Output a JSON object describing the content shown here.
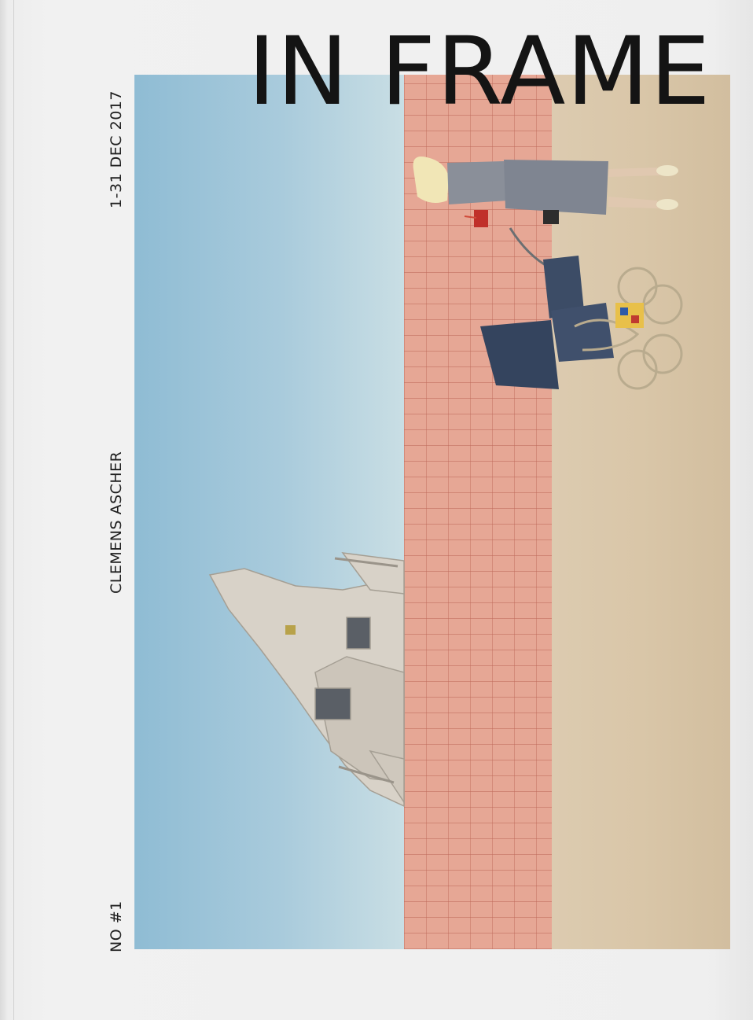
{
  "cover": {
    "title": "IN FRAME",
    "date": "1-31 DEC 2017",
    "artist": "CLEMENS ASCHER",
    "issue": "NO #1"
  },
  "colors": {
    "background": "#efefef",
    "text": "#141414",
    "sky": "#a9cbdc",
    "wall": "#e6a795",
    "sand": "#d9c6a8"
  }
}
